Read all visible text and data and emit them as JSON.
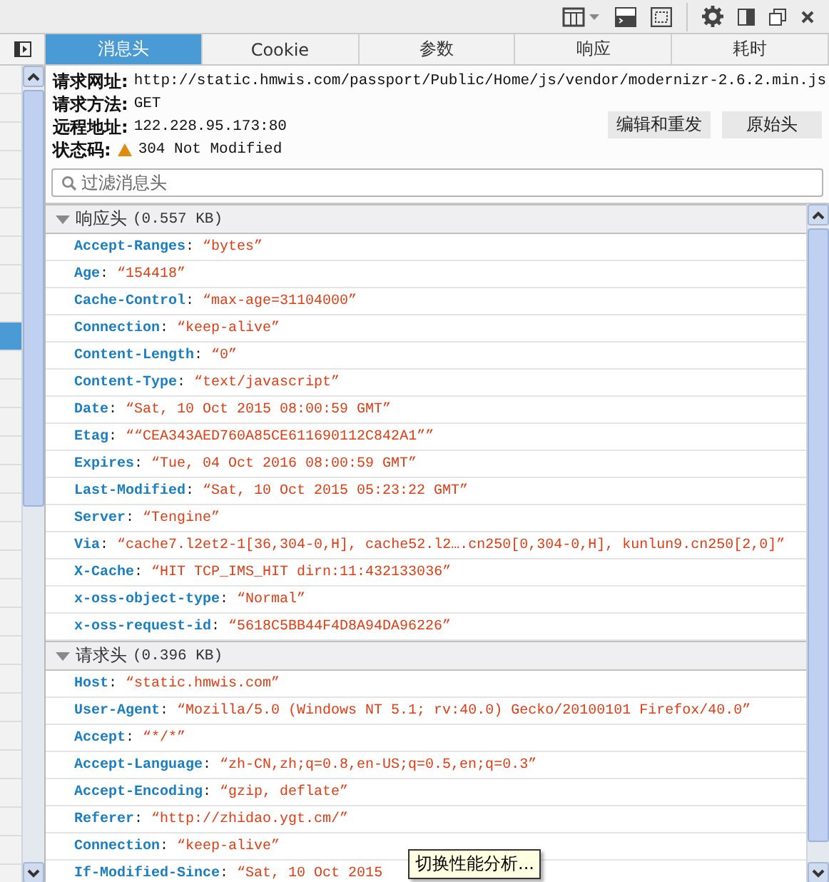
{
  "tabs": [
    {
      "label": "消息头",
      "selected": true
    },
    {
      "label": "Cookie",
      "selected": false
    },
    {
      "label": "参数",
      "selected": false
    },
    {
      "label": "响应",
      "selected": false
    },
    {
      "label": "耗时",
      "selected": false
    }
  ],
  "request_list": {
    "rows": [
      {
        "selected": false
      },
      {
        "selected": false
      },
      {
        "selected": false
      },
      {
        "selected": false
      },
      {
        "selected": false
      },
      {
        "selected": false
      },
      {
        "selected": false
      },
      {
        "selected": false
      },
      {
        "selected": false
      },
      {
        "selected": true
      },
      {
        "selected": false
      },
      {
        "selected": false
      },
      {
        "selected": false
      },
      {
        "selected": false
      },
      {
        "selected": false
      },
      {
        "selected": false
      },
      {
        "selected": false
      },
      {
        "selected": false
      },
      {
        "selected": false
      },
      {
        "selected": false
      },
      {
        "selected": false
      },
      {
        "selected": false
      },
      {
        "selected": false
      },
      {
        "selected": false
      },
      {
        "selected": false
      },
      {
        "selected": false
      },
      {
        "selected": false
      },
      {
        "selected": false
      }
    ]
  },
  "summary": [
    {
      "label": "请求网址:",
      "value": "http://static.hmwis.com/passport/Public/Home/js/vendor/modernizr-2.6.2.min.js",
      "kind": "text"
    },
    {
      "label": "请求方法:",
      "value": "GET",
      "kind": "text"
    },
    {
      "label": "远程地址:",
      "value": "122.228.95.173:80",
      "kind": "text"
    },
    {
      "label": "状态码:",
      "value": "304 Not Modified",
      "kind": "status"
    }
  ],
  "buttons": [
    "编辑和重发",
    "原始头"
  ],
  "filter": {
    "placeholder": "过滤消息头"
  },
  "sections": [
    {
      "title": "响应头",
      "size": "(0.557 KB)",
      "expanded": true,
      "headers": [
        {
          "name": "Accept-Ranges",
          "value": "“bytes”"
        },
        {
          "name": "Age",
          "value": "“154418”"
        },
        {
          "name": "Cache-Control",
          "value": "“max-age=31104000”"
        },
        {
          "name": "Connection",
          "value": "“keep-alive”"
        },
        {
          "name": "Content-Length",
          "value": "“0”"
        },
        {
          "name": "Content-Type",
          "value": "“text/javascript”"
        },
        {
          "name": "Date",
          "value": "“Sat, 10 Oct 2015 08:00:59 GMT”"
        },
        {
          "name": "Etag",
          "value": "““CEA343AED760A85CE611690112C842A1””"
        },
        {
          "name": "Expires",
          "value": "“Tue, 04 Oct 2016 08:00:59 GMT”"
        },
        {
          "name": "Last-Modified",
          "value": "“Sat, 10 Oct 2015 05:23:22 GMT”"
        },
        {
          "name": "Server",
          "value": "“Tengine”"
        },
        {
          "name": "Via",
          "value": "“cache7.l2et2-1[36,304-0,H], cache52.l2….cn250[0,304-0,H], kunlun9.cn250[2,0]”"
        },
        {
          "name": "X-Cache",
          "value": "“HIT TCP_IMS_HIT dirn:11:432133036”"
        },
        {
          "name": "x-oss-object-type",
          "value": "“Normal”"
        },
        {
          "name": "x-oss-request-id",
          "value": "“5618C5BB44F4D8A94DA96226”"
        }
      ]
    },
    {
      "title": "请求头",
      "size": "(0.396 KB)",
      "expanded": true,
      "headers": [
        {
          "name": "Host",
          "value": "“static.hmwis.com”"
        },
        {
          "name": "User-Agent",
          "value": "“Mozilla/5.0 (Windows NT 5.1; rv:40.0) Gecko/20100101 Firefox/40.0”"
        },
        {
          "name": "Accept",
          "value": "“*/*”"
        },
        {
          "name": "Accept-Language",
          "value": "“zh-CN,zh;q=0.8,en-US;q=0.5,en;q=0.3”"
        },
        {
          "name": "Accept-Encoding",
          "value": "“gzip, deflate”"
        },
        {
          "name": "Referer",
          "value": "“http://zhidao.ygt.cm/”"
        },
        {
          "name": "Connection",
          "value": "“keep-alive”"
        },
        {
          "name": "If-Modified-Since",
          "value": "“Sat, 10 Oct 2015"
        }
      ]
    }
  ],
  "separator": ":",
  "tooltip": "切换性能分析..."
}
